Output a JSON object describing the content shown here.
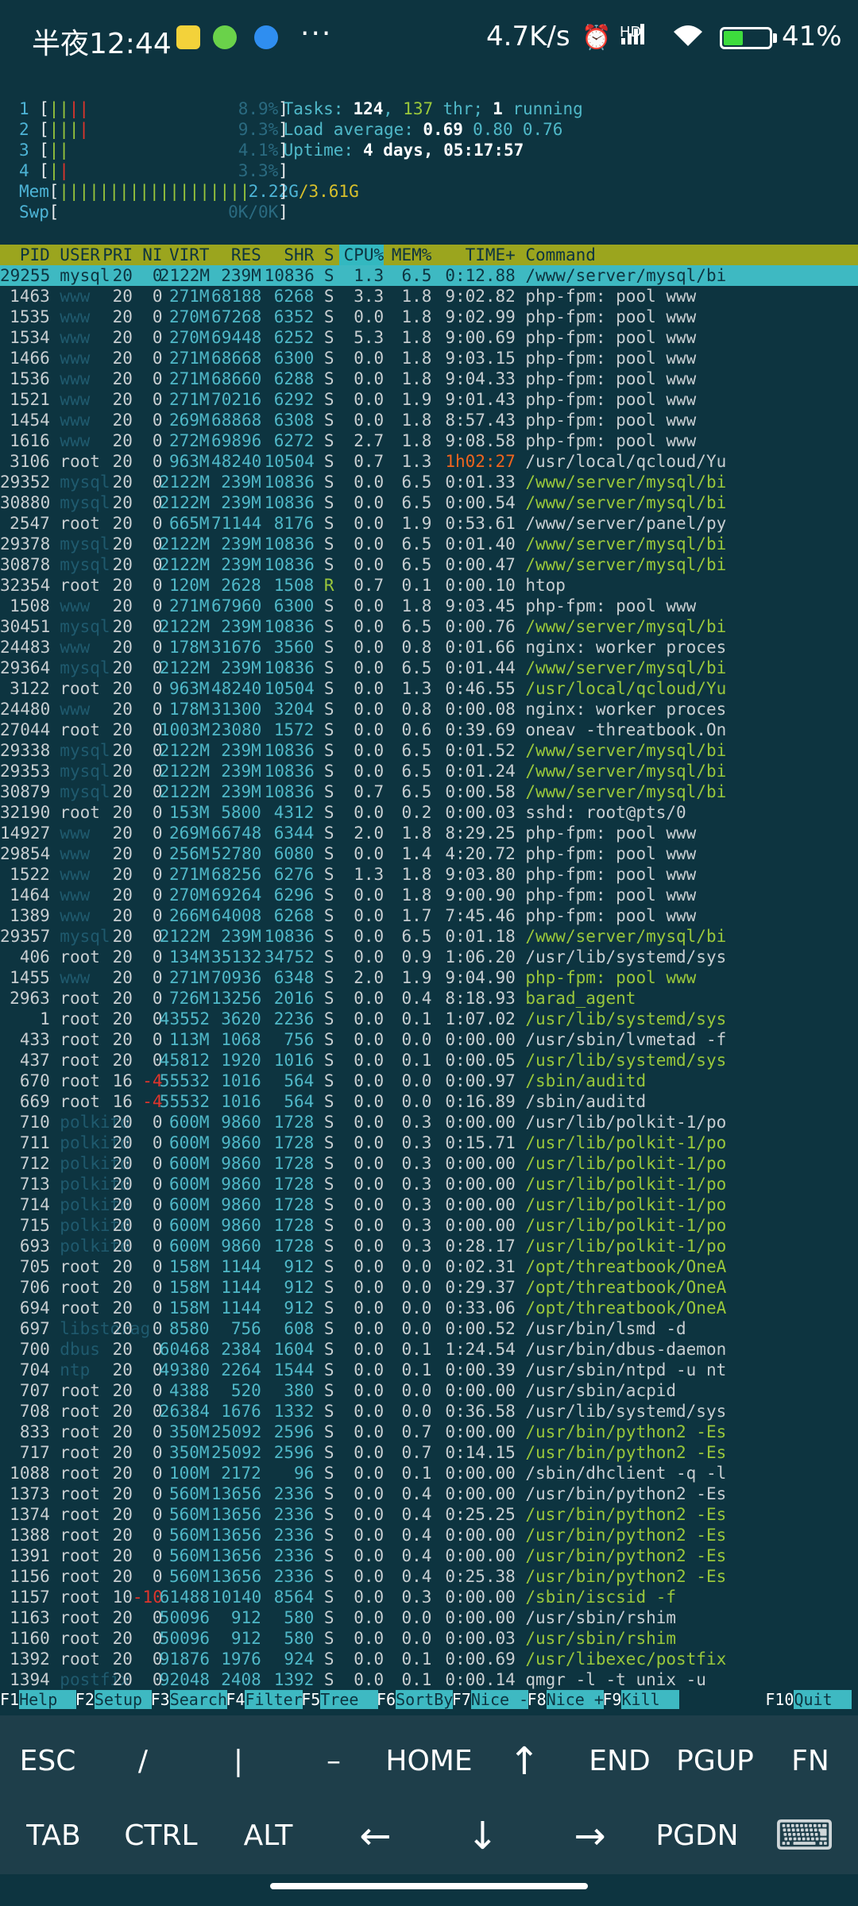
{
  "status_bar": {
    "time": "半夜12:44",
    "net_speed": "4.7K/s",
    "battery_pct": "41%",
    "battery_level": 0.41,
    "signal": "HD",
    "icons": [
      "notes-app-icon",
      "wechat-icon",
      "browser-icon",
      "more-dots-icon",
      "alarm-icon",
      "signal-icon",
      "wifi-icon",
      "battery-charging-icon"
    ]
  },
  "meters": [
    {
      "label": "1",
      "bar": [
        [
          "||",
          "green"
        ],
        [
          "||",
          "red"
        ]
      ],
      "value": "8.9%"
    },
    {
      "label": "2",
      "bar": [
        [
          "|||",
          "green"
        ],
        [
          "|",
          "red"
        ]
      ],
      "value": "9.3%"
    },
    {
      "label": "3",
      "bar": [
        [
          "||",
          "green"
        ]
      ],
      "value": "4.1%"
    },
    {
      "label": "4",
      "bar": [
        [
          "|",
          "green"
        ],
        [
          "|",
          "red"
        ]
      ],
      "value": "3.3%"
    }
  ],
  "mem": {
    "label": "Mem",
    "bars": "|||||||||||||||||||",
    "value": "2.22G/3.61G"
  },
  "swp": {
    "label": "Swp",
    "value": "0K/0K"
  },
  "tasks": {
    "label": "Tasks:",
    "count": "124",
    "sep": ", ",
    "thr": "137",
    "thr_label": "thr;",
    "running": "1",
    "running_label": "running"
  },
  "load": {
    "label": "Load average:",
    "v1": "0.69",
    "v2": "0.80",
    "v3": "0.76"
  },
  "uptime": {
    "label": "Uptime:",
    "value": "4 days, 05:17:57"
  },
  "columns": [
    "PID",
    "USER",
    "PRI",
    "NI",
    "VIRT",
    "RES",
    "SHR",
    "S",
    "CPU%",
    "MEM%",
    "TIME+",
    "Command"
  ],
  "processes": [
    [
      "29255",
      "mysql",
      "20",
      "0",
      "2122M",
      "239M",
      "10836",
      "S",
      "1.3",
      "6.5",
      "0:12.88",
      "/www/server/mysql/bi"
    ],
    [
      "1463",
      "www",
      "20",
      "0",
      "271M",
      "68188",
      "6268",
      "S",
      "3.3",
      "1.8",
      "9:02.82",
      "php-fpm: pool www"
    ],
    [
      "1535",
      "www",
      "20",
      "0",
      "270M",
      "67268",
      "6352",
      "S",
      "0.0",
      "1.8",
      "9:02.99",
      "php-fpm: pool www"
    ],
    [
      "1534",
      "www",
      "20",
      "0",
      "270M",
      "69448",
      "6252",
      "S",
      "5.3",
      "1.8",
      "9:00.69",
      "php-fpm: pool www"
    ],
    [
      "1466",
      "www",
      "20",
      "0",
      "271M",
      "68668",
      "6300",
      "S",
      "0.0",
      "1.8",
      "9:03.15",
      "php-fpm: pool www"
    ],
    [
      "1536",
      "www",
      "20",
      "0",
      "271M",
      "68660",
      "6288",
      "S",
      "0.0",
      "1.8",
      "9:04.33",
      "php-fpm: pool www"
    ],
    [
      "1521",
      "www",
      "20",
      "0",
      "271M",
      "70216",
      "6292",
      "S",
      "0.0",
      "1.9",
      "9:01.43",
      "php-fpm: pool www"
    ],
    [
      "1454",
      "www",
      "20",
      "0",
      "269M",
      "68868",
      "6308",
      "S",
      "0.0",
      "1.8",
      "8:57.43",
      "php-fpm: pool www"
    ],
    [
      "1616",
      "www",
      "20",
      "0",
      "272M",
      "69896",
      "6272",
      "S",
      "2.7",
      "1.8",
      "9:08.58",
      "php-fpm: pool www"
    ],
    [
      "3106",
      "root",
      "20",
      "0",
      "963M",
      "48240",
      "10504",
      "S",
      "0.7",
      "1.3",
      "1h02:27",
      "/usr/local/qcloud/Yu"
    ],
    [
      "29352",
      "mysql",
      "20",
      "0",
      "2122M",
      "239M",
      "10836",
      "S",
      "0.0",
      "6.5",
      "0:01.33",
      "/www/server/mysql/bi"
    ],
    [
      "30880",
      "mysql",
      "20",
      "0",
      "2122M",
      "239M",
      "10836",
      "S",
      "0.0",
      "6.5",
      "0:00.54",
      "/www/server/mysql/bi"
    ],
    [
      "2547",
      "root",
      "20",
      "0",
      "665M",
      "71144",
      "8176",
      "S",
      "0.0",
      "1.9",
      "0:53.61",
      "/www/server/panel/py"
    ],
    [
      "29378",
      "mysql",
      "20",
      "0",
      "2122M",
      "239M",
      "10836",
      "S",
      "0.0",
      "6.5",
      "0:01.40",
      "/www/server/mysql/bi"
    ],
    [
      "30878",
      "mysql",
      "20",
      "0",
      "2122M",
      "239M",
      "10836",
      "S",
      "0.0",
      "6.5",
      "0:00.47",
      "/www/server/mysql/bi"
    ],
    [
      "32354",
      "root",
      "20",
      "0",
      "120M",
      "2628",
      "1508",
      "R",
      "0.7",
      "0.1",
      "0:00.10",
      "htop"
    ],
    [
      "1508",
      "www",
      "20",
      "0",
      "271M",
      "67960",
      "6300",
      "S",
      "0.0",
      "1.8",
      "9:03.45",
      "php-fpm: pool www"
    ],
    [
      "30451",
      "mysql",
      "20",
      "0",
      "2122M",
      "239M",
      "10836",
      "S",
      "0.0",
      "6.5",
      "0:00.76",
      "/www/server/mysql/bi"
    ],
    [
      "24483",
      "www",
      "20",
      "0",
      "178M",
      "31676",
      "3560",
      "S",
      "0.0",
      "0.8",
      "0:01.66",
      "nginx: worker proces"
    ],
    [
      "29364",
      "mysql",
      "20",
      "0",
      "2122M",
      "239M",
      "10836",
      "S",
      "0.0",
      "6.5",
      "0:01.44",
      "/www/server/mysql/bi"
    ],
    [
      "3122",
      "root",
      "20",
      "0",
      "963M",
      "48240",
      "10504",
      "S",
      "0.0",
      "1.3",
      "0:46.55",
      "/usr/local/qcloud/Yu"
    ],
    [
      "24480",
      "www",
      "20",
      "0",
      "178M",
      "31300",
      "3204",
      "S",
      "0.0",
      "0.8",
      "0:00.08",
      "nginx: worker proces"
    ],
    [
      "27044",
      "root",
      "20",
      "0",
      "1003M",
      "23080",
      "1572",
      "S",
      "0.0",
      "0.6",
      "0:39.69",
      "oneav -threatbook.On"
    ],
    [
      "29338",
      "mysql",
      "20",
      "0",
      "2122M",
      "239M",
      "10836",
      "S",
      "0.0",
      "6.5",
      "0:01.52",
      "/www/server/mysql/bi"
    ],
    [
      "29353",
      "mysql",
      "20",
      "0",
      "2122M",
      "239M",
      "10836",
      "S",
      "0.0",
      "6.5",
      "0:01.24",
      "/www/server/mysql/bi"
    ],
    [
      "30879",
      "mysql",
      "20",
      "0",
      "2122M",
      "239M",
      "10836",
      "S",
      "0.7",
      "6.5",
      "0:00.58",
      "/www/server/mysql/bi"
    ],
    [
      "32190",
      "root",
      "20",
      "0",
      "153M",
      "5800",
      "4312",
      "S",
      "0.0",
      "0.2",
      "0:00.03",
      "sshd: root@pts/0"
    ],
    [
      "14927",
      "www",
      "20",
      "0",
      "269M",
      "66748",
      "6344",
      "S",
      "2.0",
      "1.8",
      "8:29.25",
      "php-fpm: pool www"
    ],
    [
      "29854",
      "www",
      "20",
      "0",
      "256M",
      "52780",
      "6080",
      "S",
      "0.0",
      "1.4",
      "4:20.72",
      "php-fpm: pool www"
    ],
    [
      "1522",
      "www",
      "20",
      "0",
      "271M",
      "68256",
      "6276",
      "S",
      "1.3",
      "1.8",
      "9:03.80",
      "php-fpm: pool www"
    ],
    [
      "1464",
      "www",
      "20",
      "0",
      "270M",
      "69264",
      "6296",
      "S",
      "0.0",
      "1.8",
      "9:00.90",
      "php-fpm: pool www"
    ],
    [
      "1389",
      "www",
      "20",
      "0",
      "266M",
      "64008",
      "6268",
      "S",
      "0.0",
      "1.7",
      "7:45.46",
      "php-fpm: pool www"
    ],
    [
      "29357",
      "mysql",
      "20",
      "0",
      "2122M",
      "239M",
      "10836",
      "S",
      "0.0",
      "6.5",
      "0:01.18",
      "/www/server/mysql/bi"
    ],
    [
      "406",
      "root",
      "20",
      "0",
      "134M",
      "35132",
      "34752",
      "S",
      "0.0",
      "0.9",
      "1:06.20",
      "/usr/lib/systemd/sys"
    ],
    [
      "1455",
      "www",
      "20",
      "0",
      "271M",
      "70936",
      "6348",
      "S",
      "2.0",
      "1.9",
      "9:04.90",
      "php-fpm: pool www"
    ],
    [
      "2963",
      "root",
      "20",
      "0",
      "726M",
      "13256",
      "2016",
      "S",
      "0.0",
      "0.4",
      "8:18.93",
      "barad_agent"
    ],
    [
      "1",
      "root",
      "20",
      "0",
      "43552",
      "3620",
      "2236",
      "S",
      "0.0",
      "0.1",
      "1:07.02",
      "/usr/lib/systemd/sys"
    ],
    [
      "433",
      "root",
      "20",
      "0",
      "113M",
      "1068",
      "756",
      "S",
      "0.0",
      "0.0",
      "0:00.00",
      "/usr/sbin/lvmetad -f"
    ],
    [
      "437",
      "root",
      "20",
      "0",
      "45812",
      "1920",
      "1016",
      "S",
      "0.0",
      "0.1",
      "0:00.05",
      "/usr/lib/systemd/sys"
    ],
    [
      "670",
      "root",
      "16",
      "-4",
      "55532",
      "1016",
      "564",
      "S",
      "0.0",
      "0.0",
      "0:00.97",
      "/sbin/auditd"
    ],
    [
      "669",
      "root",
      "16",
      "-4",
      "55532",
      "1016",
      "564",
      "S",
      "0.0",
      "0.0",
      "0:16.89",
      "/sbin/auditd"
    ],
    [
      "710",
      "polkitd",
      "20",
      "0",
      "600M",
      "9860",
      "1728",
      "S",
      "0.0",
      "0.3",
      "0:00.00",
      "/usr/lib/polkit-1/po"
    ],
    [
      "711",
      "polkitd",
      "20",
      "0",
      "600M",
      "9860",
      "1728",
      "S",
      "0.0",
      "0.3",
      "0:15.71",
      "/usr/lib/polkit-1/po"
    ],
    [
      "712",
      "polkitd",
      "20",
      "0",
      "600M",
      "9860",
      "1728",
      "S",
      "0.0",
      "0.3",
      "0:00.00",
      "/usr/lib/polkit-1/po"
    ],
    [
      "713",
      "polkitd",
      "20",
      "0",
      "600M",
      "9860",
      "1728",
      "S",
      "0.0",
      "0.3",
      "0:00.00",
      "/usr/lib/polkit-1/po"
    ],
    [
      "714",
      "polkitd",
      "20",
      "0",
      "600M",
      "9860",
      "1728",
      "S",
      "0.0",
      "0.3",
      "0:00.00",
      "/usr/lib/polkit-1/po"
    ],
    [
      "715",
      "polkitd",
      "20",
      "0",
      "600M",
      "9860",
      "1728",
      "S",
      "0.0",
      "0.3",
      "0:00.00",
      "/usr/lib/polkit-1/po"
    ],
    [
      "693",
      "polkitd",
      "20",
      "0",
      "600M",
      "9860",
      "1728",
      "S",
      "0.0",
      "0.3",
      "0:28.17",
      "/usr/lib/polkit-1/po"
    ],
    [
      "705",
      "root",
      "20",
      "0",
      "158M",
      "1144",
      "912",
      "S",
      "0.0",
      "0.0",
      "0:02.31",
      "/opt/threatbook/OneA"
    ],
    [
      "706",
      "root",
      "20",
      "0",
      "158M",
      "1144",
      "912",
      "S",
      "0.0",
      "0.0",
      "0:29.37",
      "/opt/threatbook/OneA"
    ],
    [
      "694",
      "root",
      "20",
      "0",
      "158M",
      "1144",
      "912",
      "S",
      "0.0",
      "0.0",
      "0:33.06",
      "/opt/threatbook/OneA"
    ],
    [
      "697",
      "libstorag",
      "20",
      "0",
      "8580",
      "756",
      "608",
      "S",
      "0.0",
      "0.0",
      "0:00.52",
      "/usr/bin/lsmd -d"
    ],
    [
      "700",
      "dbus",
      "20",
      "0",
      "60468",
      "2384",
      "1604",
      "S",
      "0.0",
      "0.1",
      "1:24.54",
      "/usr/bin/dbus-daemon"
    ],
    [
      "704",
      "ntp",
      "20",
      "0",
      "49380",
      "2264",
      "1544",
      "S",
      "0.0",
      "0.1",
      "0:00.39",
      "/usr/sbin/ntpd -u nt"
    ],
    [
      "707",
      "root",
      "20",
      "0",
      "4388",
      "520",
      "380",
      "S",
      "0.0",
      "0.0",
      "0:00.00",
      "/usr/sbin/acpid"
    ],
    [
      "708",
      "root",
      "20",
      "0",
      "26384",
      "1676",
      "1332",
      "S",
      "0.0",
      "0.0",
      "0:36.58",
      "/usr/lib/systemd/sys"
    ],
    [
      "833",
      "root",
      "20",
      "0",
      "350M",
      "25092",
      "2596",
      "S",
      "0.0",
      "0.7",
      "0:00.00",
      "/usr/bin/python2 -Es"
    ],
    [
      "717",
      "root",
      "20",
      "0",
      "350M",
      "25092",
      "2596",
      "S",
      "0.0",
      "0.7",
      "0:14.15",
      "/usr/bin/python2 -Es"
    ],
    [
      "1088",
      "root",
      "20",
      "0",
      "100M",
      "2172",
      "96",
      "S",
      "0.0",
      "0.1",
      "0:00.00",
      "/sbin/dhclient -q -l"
    ],
    [
      "1373",
      "root",
      "20",
      "0",
      "560M",
      "13656",
      "2336",
      "S",
      "0.0",
      "0.4",
      "0:00.00",
      "/usr/bin/python2 -Es"
    ],
    [
      "1374",
      "root",
      "20",
      "0",
      "560M",
      "13656",
      "2336",
      "S",
      "0.0",
      "0.4",
      "0:25.25",
      "/usr/bin/python2 -Es"
    ],
    [
      "1388",
      "root",
      "20",
      "0",
      "560M",
      "13656",
      "2336",
      "S",
      "0.0",
      "0.4",
      "0:00.00",
      "/usr/bin/python2 -Es"
    ],
    [
      "1391",
      "root",
      "20",
      "0",
      "560M",
      "13656",
      "2336",
      "S",
      "0.0",
      "0.4",
      "0:00.00",
      "/usr/bin/python2 -Es"
    ],
    [
      "1156",
      "root",
      "20",
      "0",
      "560M",
      "13656",
      "2336",
      "S",
      "0.0",
      "0.4",
      "0:25.38",
      "/usr/bin/python2 -Es"
    ],
    [
      "1157",
      "root",
      "10",
      "-10",
      "61488",
      "10140",
      "8564",
      "S",
      "0.0",
      "0.3",
      "0:00.00",
      "/sbin/iscsid -f"
    ],
    [
      "1163",
      "root",
      "20",
      "0",
      "50096",
      "912",
      "580",
      "S",
      "0.0",
      "0.0",
      "0:00.00",
      "/usr/sbin/rshim"
    ],
    [
      "1160",
      "root",
      "20",
      "0",
      "50096",
      "912",
      "580",
      "S",
      "0.0",
      "0.0",
      "0:00.03",
      "/usr/sbin/rshim"
    ],
    [
      "1392",
      "root",
      "20",
      "0",
      "91876",
      "1976",
      "924",
      "S",
      "0.0",
      "0.1",
      "0:00.69",
      "/usr/libexec/postfix"
    ],
    [
      "1394",
      "postfix",
      "20",
      "0",
      "92048",
      "2408",
      "1392",
      "S",
      "0.0",
      "0.1",
      "0:00.14",
      "qmgr -l -t unix -u"
    ]
  ],
  "thread_rows": [
    10,
    11,
    13,
    14,
    17,
    19,
    20,
    23,
    24,
    25,
    32,
    34,
    36,
    38,
    39,
    42,
    43,
    44,
    45,
    46,
    47,
    48,
    49,
    50,
    56,
    57,
    60,
    61,
    62,
    63,
    64,
    66,
    67
  ],
  "highlighted_commands": {
    "35": "barad_agent"
  },
  "function_keys": [
    {
      "key": "F1",
      "label": "Help  "
    },
    {
      "key": "F2",
      "label": "Setup "
    },
    {
      "key": "F3",
      "label": "Search"
    },
    {
      "key": "F4",
      "label": "Filter"
    },
    {
      "key": "F5",
      "label": "Tree  "
    },
    {
      "key": "F6",
      "label": "SortBy"
    },
    {
      "key": "F7",
      "label": "Nice -"
    },
    {
      "key": "F8",
      "label": "Nice +"
    },
    {
      "key": "F9",
      "label": "Kill  "
    },
    {
      "key": "F10",
      "label": "Quit  "
    }
  ],
  "extra_keys": {
    "row1": [
      "ESC",
      "/",
      "|",
      "–",
      "HOME",
      "↑",
      "END",
      "PGUP",
      "FN"
    ],
    "row2": [
      "TAB",
      "CTRL",
      "ALT",
      "←",
      "↓",
      "→",
      "PGDN",
      "⌨"
    ]
  },
  "colors": {
    "background": "#0d3440",
    "header": "#9ba51e",
    "selected": "#3eb9c2",
    "thread": "#9ac83b",
    "keybar": "#1e3e4a"
  }
}
